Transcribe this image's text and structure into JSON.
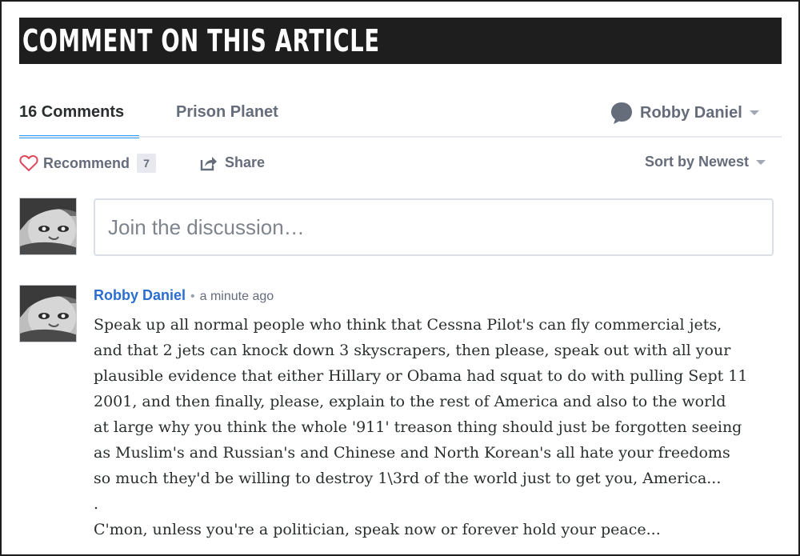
{
  "banner": {
    "title": "COMMENT ON THIS ARTICLE"
  },
  "nav": {
    "comments_tab": "16 Comments",
    "forum_tab": "Prison Planet",
    "user_name": "Robby Daniel"
  },
  "actions": {
    "recommend_label": "Recommend",
    "recommend_count": "7",
    "share_label": "Share",
    "sort_label": "Sort by Newest"
  },
  "compose": {
    "placeholder": "Join the discussion…"
  },
  "post": {
    "author": "Robby Daniel",
    "separator": "•",
    "time": "a minute ago",
    "lines": [
      "Speak up all normal people who think that Cessna Pilot's can fly commercial jets,",
      "and that 2 jets can knock down 3 skyscrapers, then please, speak out with all your",
      "plausible evidence that either Hillary or Obama had squat to do with pulling Sept 11",
      "2001, and then finally, please, explain to the rest of America and also to the world",
      "at large why you think the whole '911' treason thing should just be forgotten seeing",
      "as Muslim's and Russian's and Chinese and North Korean's all hate your freedoms",
      "so much they'd be willing to destroy 1\\3rd of the world just to get you, America...",
      ".",
      "C'mon, unless you're a politician, speak now or forever hold your peace..."
    ]
  },
  "icons": {
    "user_menu": "chat-bubble-icon",
    "recommend": "heart-icon",
    "share": "share-icon",
    "dropdown": "chevron-down-icon"
  },
  "colors": {
    "banner_bg": "#1e1e1e",
    "accent": "#2e9fff",
    "author_link": "#2a6ecf",
    "muted_text": "#656c7a",
    "heart": "#e0475a"
  }
}
